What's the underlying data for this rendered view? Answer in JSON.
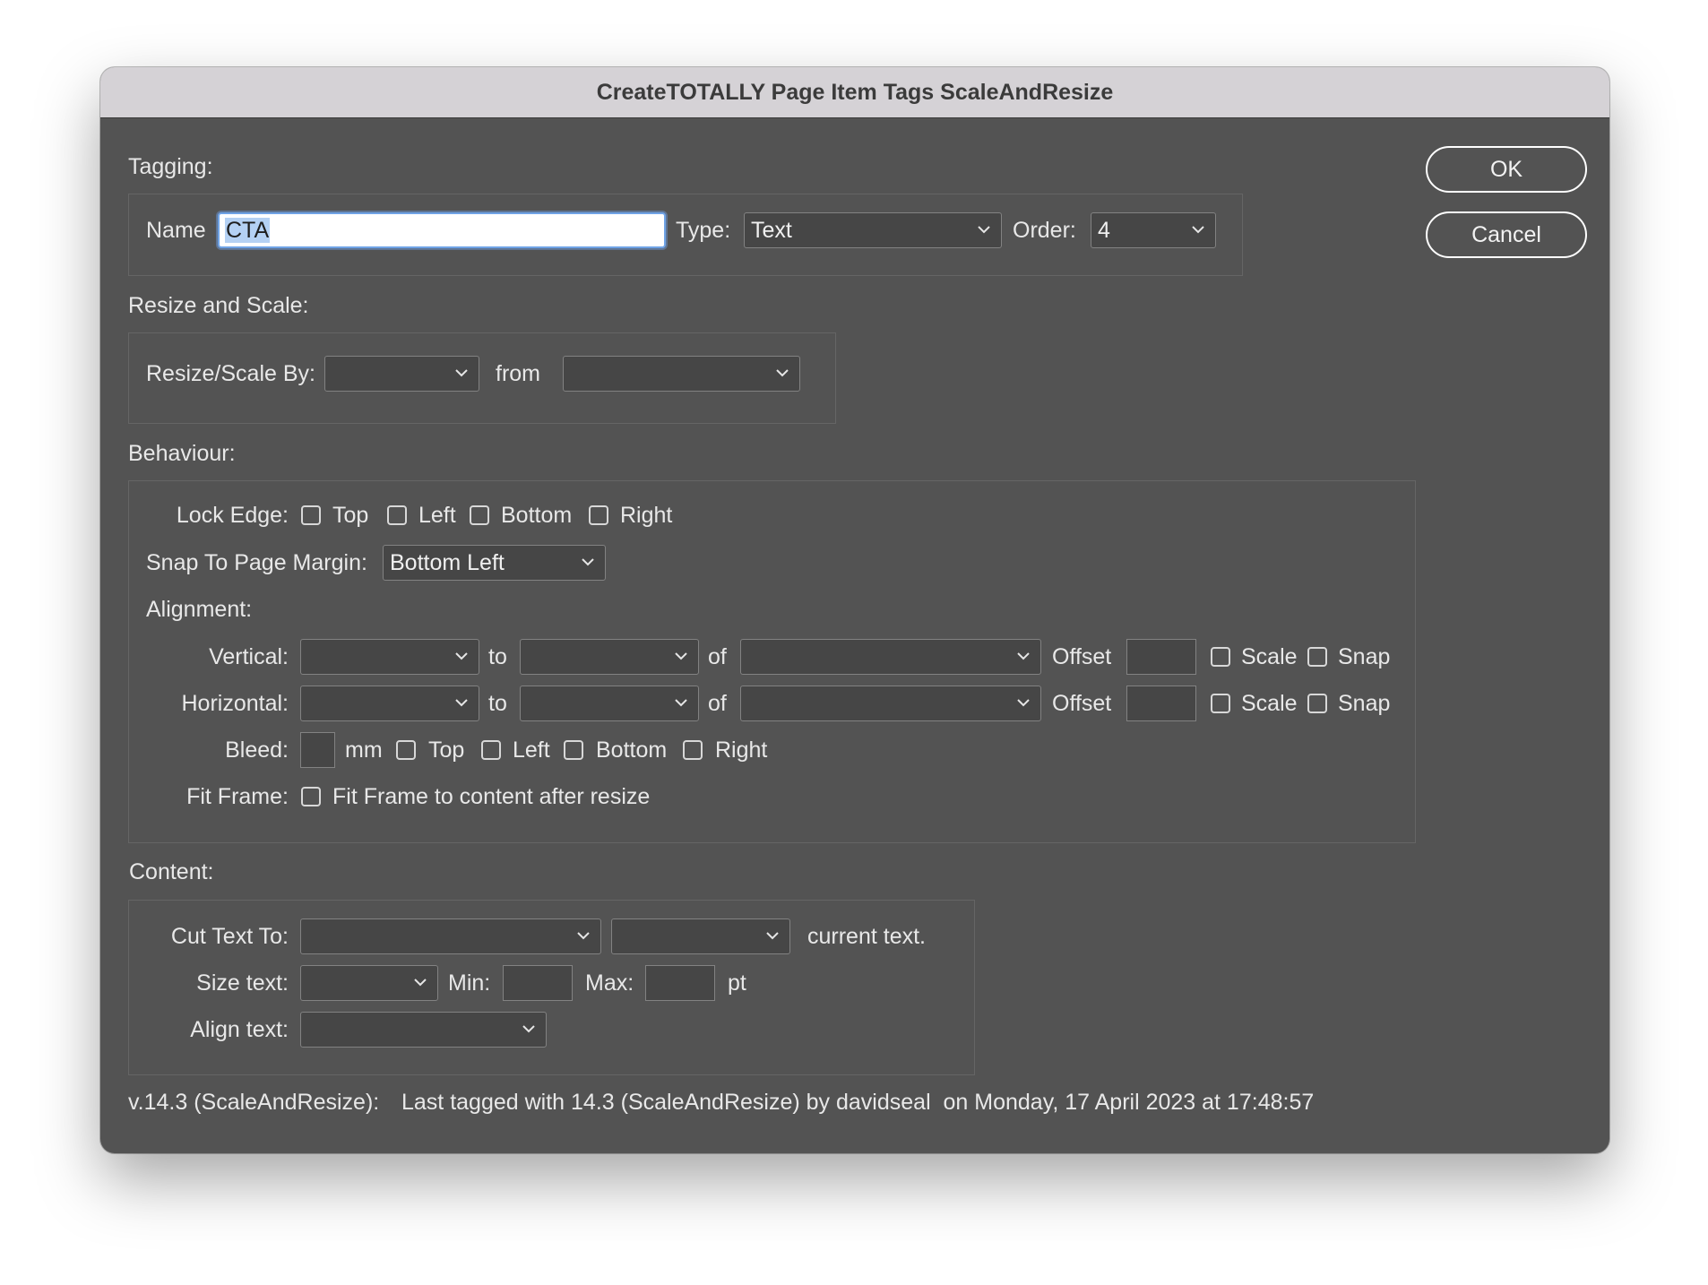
{
  "window": {
    "title": "CreateTOTALLY Page Item Tags ScaleAndResize"
  },
  "buttons": {
    "ok": "OK",
    "cancel": "Cancel"
  },
  "tagging": {
    "heading": "Tagging:",
    "name_label": "Name",
    "name_value": "CTA",
    "type_label": "Type:",
    "type_value": "Text",
    "order_label": "Order:",
    "order_value": "4"
  },
  "resize": {
    "heading": "Resize and Scale:",
    "by_label": "Resize/Scale By:",
    "by_value": "",
    "from_label": "from",
    "from_value": ""
  },
  "behaviour": {
    "heading": "Behaviour:",
    "lock_edge_label": "Lock Edge:",
    "lock_edge_options": [
      "Top",
      "Left",
      "Bottom",
      "Right"
    ],
    "snap_label": "Snap To Page Margin:",
    "snap_value": "Bottom Left",
    "alignment_label": "Alignment:",
    "vertical_label": "Vertical:",
    "horizontal_label": "Horizontal:",
    "to_label": "to",
    "of_label": "of",
    "offset_label": "Offset",
    "scale_label": "Scale",
    "snap_check_label": "Snap",
    "bleed_label": "Bleed:",
    "bleed_unit": "mm",
    "bleed_options": [
      "Top",
      "Left",
      "Bottom",
      "Right"
    ],
    "fit_frame_label": "Fit Frame:",
    "fit_frame_option": "Fit Frame to content after resize"
  },
  "content": {
    "heading": "Content:",
    "cut_text_label": "Cut Text To:",
    "current_text_label": "current text.",
    "size_text_label": "Size text:",
    "min_label": "Min:",
    "max_label": "Max:",
    "pt_label": "pt",
    "align_text_label": "Align text:"
  },
  "footer": {
    "version": "v.14.3 (ScaleAndResize):",
    "status": "Last tagged with 14.3 (ScaleAndResize) by davidseal  on Monday, 17 April 2023 at 17:48:57"
  },
  "colors": {
    "dialog_bg": "#535353",
    "titlebar_bg": "#d5d2d6",
    "focus_ring": "#6fa3e6"
  },
  "icons": {
    "dropdown": "chevron-down-icon"
  }
}
